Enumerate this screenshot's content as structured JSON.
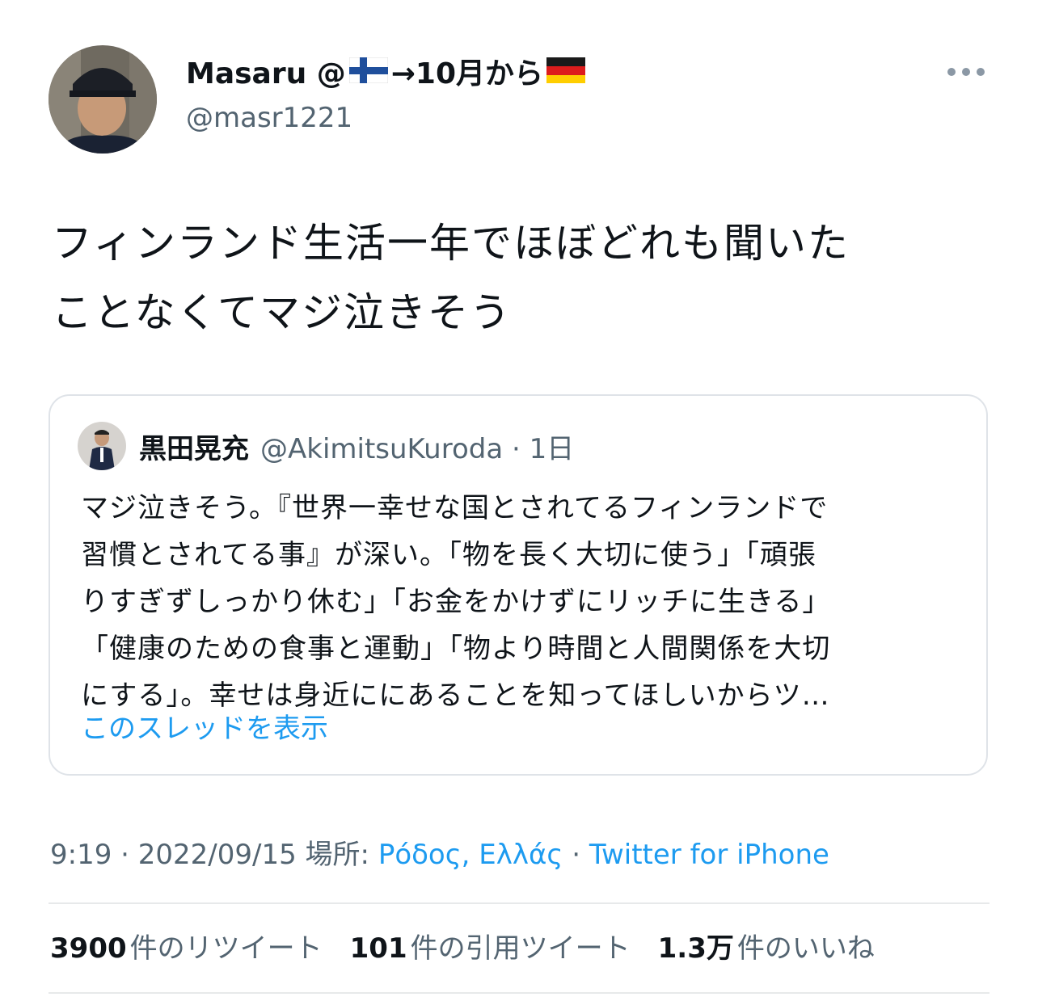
{
  "author": {
    "name": "Masaru @",
    "arrow_text": "→10月から",
    "handle": "@masr1221"
  },
  "tweet": {
    "line1": "フィンランド生活一年でほぼどれも聞いた",
    "line2": "ことなくてマジ泣きそう"
  },
  "quote": {
    "name": "黒田晃充",
    "handle": "@AkimitsuKuroda · 1日",
    "lines": [
      "マジ泣きそう。『世界一幸せな国とされてるフィンランドで",
      "習慣とされてる事』が深い。「物を長く大切に使う」「頑張",
      "りすぎずしっかり休む」「お金をかけずにリッチに生きる」",
      "「健康のための食事と運動」「物より時間と人間関係を大切",
      "にする」。幸せは身近ににあることを知ってほしいからツ…"
    ],
    "show_thread": "このスレッドを表示"
  },
  "meta": {
    "time": "9:19 · 2022/09/15 場所: ",
    "location": "Ρόδος, Ελλάς",
    "separator": " · ",
    "source": "Twitter for iPhone"
  },
  "stats": {
    "retweets_count": "3900",
    "retweets_label": "件のリツイート",
    "quotes_count": "101",
    "quotes_label": "件の引用ツイート",
    "likes_count": "1.3万",
    "likes_label": "件のいいね"
  },
  "colors": {
    "link": "#1d9bf0",
    "secondary_text": "#536471",
    "primary_text": "#0f1419"
  }
}
